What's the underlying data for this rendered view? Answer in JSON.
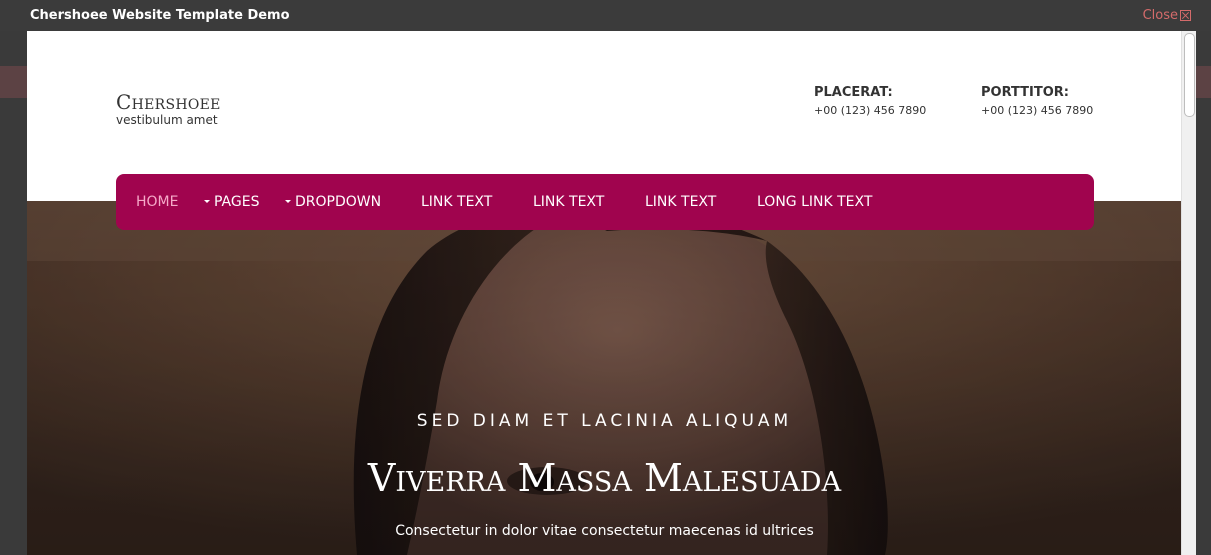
{
  "modal": {
    "title": "Chershoee Website Template Demo",
    "close_label": "Close"
  },
  "header": {
    "logo_title": "Chershoee",
    "logo_tagline": "vestibulum amet",
    "contacts": [
      {
        "label": "PLACERAT:",
        "phone": "+00 (123) 456 7890"
      },
      {
        "label": "PORTTITOR:",
        "phone": "+00 (123) 456 7890"
      }
    ]
  },
  "nav": {
    "items": [
      {
        "label": "HOME",
        "active": true,
        "dropdown": false
      },
      {
        "label": "PAGES",
        "active": false,
        "dropdown": true
      },
      {
        "label": "DROPDOWN",
        "active": false,
        "dropdown": true
      },
      {
        "label": "LINK TEXT",
        "active": false,
        "dropdown": false
      },
      {
        "label": "LINK TEXT",
        "active": false,
        "dropdown": false
      },
      {
        "label": "LINK TEXT",
        "active": false,
        "dropdown": false
      },
      {
        "label": "LONG LINK TEXT",
        "active": false,
        "dropdown": false
      }
    ]
  },
  "hero": {
    "kicker": "SED DIAM ET LACINIA ALIQUAM",
    "headline": "Viverra Massa Malesuada",
    "subline": "Consectetur in dolor vitae consectetur maecenas id ultrices"
  },
  "colors": {
    "nav_bg": "#a0044e",
    "nav_active": "#f5a9c8",
    "close": "#d46b6b"
  }
}
